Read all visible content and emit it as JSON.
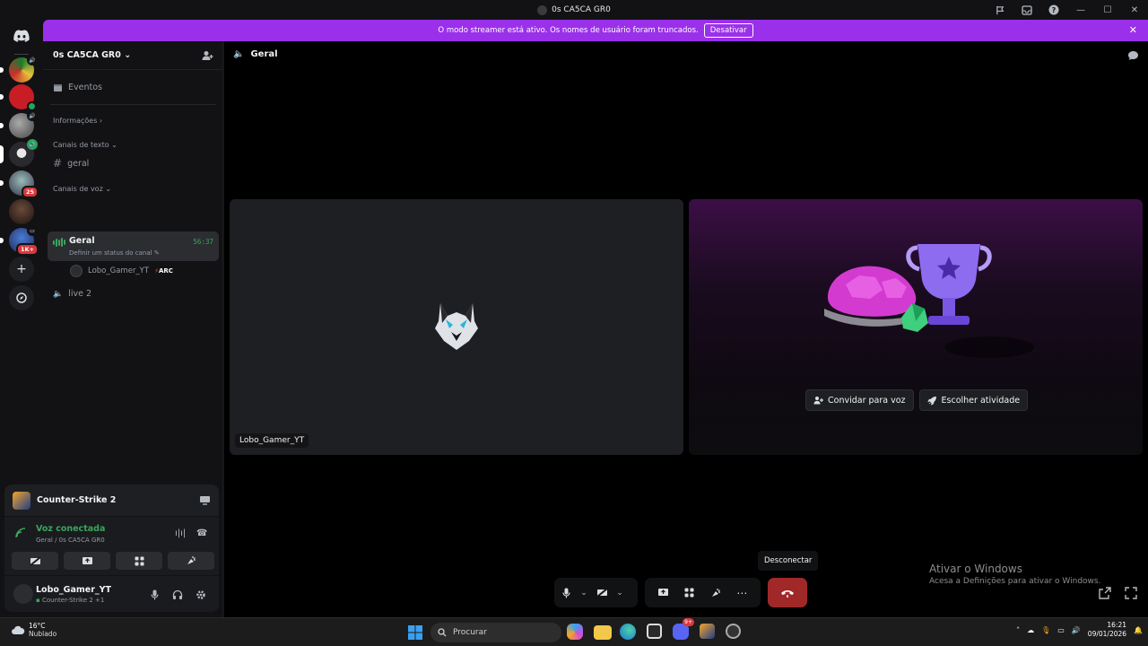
{
  "window": {
    "title": "0s CA5CA GR0"
  },
  "banner": {
    "message": "O modo streamer está ativo. Os nomes de usuário foram truncados.",
    "button": "Desativar"
  },
  "rail": {
    "badges": [
      "25",
      "1K+"
    ]
  },
  "sidebar": {
    "guild_name": "0s CA5CA GR0",
    "events": "Eventos",
    "info": "Informações",
    "text_category": "Canais de texto",
    "text_channel": "geral",
    "voice_category": "Canais de voz",
    "voice_active": {
      "name": "Geral",
      "timer": "56:37",
      "status": "Definir um status do canal"
    },
    "member": {
      "name": "Lobo_Gamer_YT",
      "tag_prefix": "⚡",
      "tag": "ARC"
    },
    "voice_other": "live 2"
  },
  "activity": {
    "title": "Counter-Strike 2"
  },
  "voice_panel": {
    "status": "Voz conectada",
    "location": "Geral / 0s CA5CA GR0"
  },
  "user": {
    "name": "Lobo_Gamer_YT",
    "status": "Counter-Strike 2 +1"
  },
  "main": {
    "channel": "Geral",
    "tile_label": "Lobo_Gamer_YT",
    "invite_button": "Convidar para voz",
    "activity_button": "Escolher atividade",
    "tooltip": "Desconectar"
  },
  "watermark": {
    "title": "Ativar o Windows",
    "subtitle": "Acesa a Definições para ativar o Windows."
  },
  "taskbar": {
    "temp": "16°C",
    "weather": "Nublado",
    "search": "Procurar",
    "time": "16:21",
    "date": "09/01/2026",
    "discord_badge": "9+"
  },
  "colors": {
    "accent": "#9b30ea",
    "voice_green": "#3ba55c",
    "danger": "#a12828"
  }
}
